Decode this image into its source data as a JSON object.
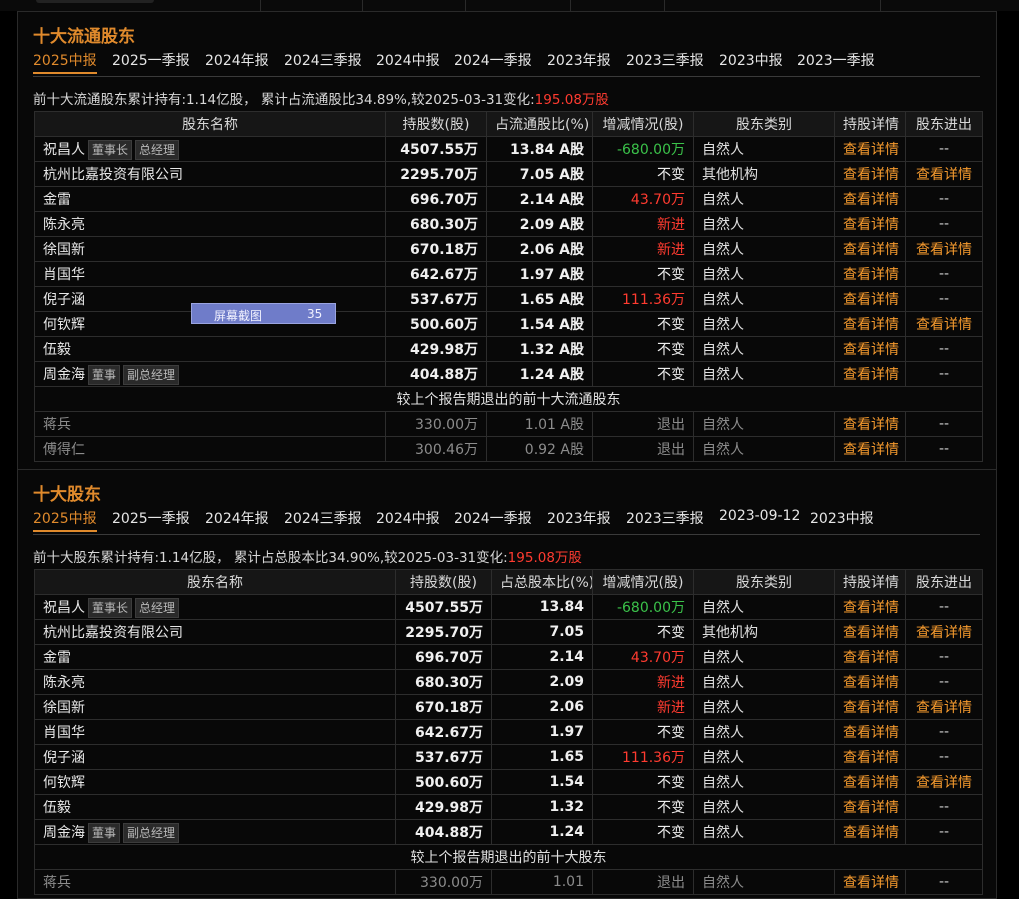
{
  "sections": [
    {
      "title": "十大流通股东",
      "tabs": [
        "2025中报",
        "2025一季报",
        "2024年报",
        "2024三季报",
        "2024中报",
        "2024一季报",
        "2023年报",
        "2023三季报",
        "2023中报",
        "2023一季报"
      ],
      "summary_prefix": "前十大流通股东累计持有:1.14亿股， 累计占流通股比34.89%,较2025-03-31变化:",
      "summary_change": "195.08万股",
      "headers": [
        "股东名称",
        "持股数(股)",
        "占流通股比(%)",
        "增减情况(股)",
        "股东类别",
        "持股详情",
        "股东进出"
      ],
      "rows": [
        {
          "name": "祝昌人",
          "tags": [
            "董事长",
            "总经理"
          ],
          "shares": "4507.55万",
          "ratio": "13.84 A股",
          "change": "-680.00万",
          "change_color": "green",
          "type": "自然人",
          "detail": "查看详情",
          "inout": "--"
        },
        {
          "name": "杭州比嘉投资有限公司",
          "tags": [],
          "shares": "2295.70万",
          "ratio": "7.05 A股",
          "change": "不变",
          "change_color": "white",
          "type": "其他机构",
          "detail": "查看详情",
          "inout": "查看详情"
        },
        {
          "name": "金雷",
          "tags": [],
          "shares": "696.70万",
          "ratio": "2.14 A股",
          "change": "43.70万",
          "change_color": "red",
          "type": "自然人",
          "detail": "查看详情",
          "inout": "--"
        },
        {
          "name": "陈永亮",
          "tags": [],
          "shares": "680.30万",
          "ratio": "2.09 A股",
          "change": "新进",
          "change_color": "red",
          "type": "自然人",
          "detail": "查看详情",
          "inout": "--"
        },
        {
          "name": "徐国新",
          "tags": [],
          "shares": "670.18万",
          "ratio": "2.06 A股",
          "change": "新进",
          "change_color": "red",
          "type": "自然人",
          "detail": "查看详情",
          "inout": "查看详情"
        },
        {
          "name": "肖国华",
          "tags": [],
          "shares": "642.67万",
          "ratio": "1.97 A股",
          "change": "不变",
          "change_color": "white",
          "type": "自然人",
          "detail": "查看详情",
          "inout": "--"
        },
        {
          "name": "倪子涵",
          "tags": [],
          "shares": "537.67万",
          "ratio": "1.65 A股",
          "change": "111.36万",
          "change_color": "red",
          "type": "自然人",
          "detail": "查看详情",
          "inout": "--"
        },
        {
          "name": "何钦辉",
          "tags": [],
          "shares": "500.60万",
          "ratio": "1.54 A股",
          "change": "不变",
          "change_color": "white",
          "type": "自然人",
          "detail": "查看详情",
          "inout": "查看详情"
        },
        {
          "name": "伍毅",
          "tags": [],
          "shares": "429.98万",
          "ratio": "1.32 A股",
          "change": "不变",
          "change_color": "white",
          "type": "自然人",
          "detail": "查看详情",
          "inout": "--"
        },
        {
          "name": "周金海",
          "tags": [
            "董事",
            "副总经理"
          ],
          "shares": "404.88万",
          "ratio": "1.24 A股",
          "change": "不变",
          "change_color": "white",
          "type": "自然人",
          "detail": "查看详情",
          "inout": "--"
        }
      ],
      "exit_label": "较上个报告期退出的前十大流通股东",
      "exited": [
        {
          "name": "蒋兵",
          "shares": "330.00万",
          "ratio": "1.01 A股",
          "change": "退出",
          "type": "自然人",
          "detail": "查看详情",
          "inout": "--"
        },
        {
          "name": "傅得仁",
          "shares": "300.46万",
          "ratio": "0.92 A股",
          "change": "退出",
          "type": "自然人",
          "detail": "查看详情",
          "inout": "--"
        }
      ]
    },
    {
      "title": "十大股东",
      "tabs": [
        "2025中报",
        "2025一季报",
        "2024年报",
        "2024三季报",
        "2024中报",
        "2024一季报",
        "2023年报",
        "2023三季报",
        "2023-09-12",
        "2023中报"
      ],
      "summary_prefix": "前十大股东累计持有:1.14亿股， 累计占总股本比34.90%,较2025-03-31变化:",
      "summary_change": "195.08万股",
      "headers": [
        "股东名称",
        "持股数(股)",
        "占总股本比(%)",
        "增减情况(股)",
        "股东类别",
        "持股详情",
        "股东进出"
      ],
      "rows": [
        {
          "name": "祝昌人",
          "tags": [
            "董事长",
            "总经理"
          ],
          "shares": "4507.55万",
          "ratio": "13.84",
          "change": "-680.00万",
          "change_color": "green",
          "type": "自然人",
          "detail": "查看详情",
          "inout": "--"
        },
        {
          "name": "杭州比嘉投资有限公司",
          "tags": [],
          "shares": "2295.70万",
          "ratio": "7.05",
          "change": "不变",
          "change_color": "white",
          "type": "其他机构",
          "detail": "查看详情",
          "inout": "查看详情"
        },
        {
          "name": "金雷",
          "tags": [],
          "shares": "696.70万",
          "ratio": "2.14",
          "change": "43.70万",
          "change_color": "red",
          "type": "自然人",
          "detail": "查看详情",
          "inout": "--"
        },
        {
          "name": "陈永亮",
          "tags": [],
          "shares": "680.30万",
          "ratio": "2.09",
          "change": "新进",
          "change_color": "red",
          "type": "自然人",
          "detail": "查看详情",
          "inout": "--"
        },
        {
          "name": "徐国新",
          "tags": [],
          "shares": "670.18万",
          "ratio": "2.06",
          "change": "新进",
          "change_color": "red",
          "type": "自然人",
          "detail": "查看详情",
          "inout": "查看详情"
        },
        {
          "name": "肖国华",
          "tags": [],
          "shares": "642.67万",
          "ratio": "1.97",
          "change": "不变",
          "change_color": "white",
          "type": "自然人",
          "detail": "查看详情",
          "inout": "--"
        },
        {
          "name": "倪子涵",
          "tags": [],
          "shares": "537.67万",
          "ratio": "1.65",
          "change": "111.36万",
          "change_color": "red",
          "type": "自然人",
          "detail": "查看详情",
          "inout": "--"
        },
        {
          "name": "何钦辉",
          "tags": [],
          "shares": "500.60万",
          "ratio": "1.54",
          "change": "不变",
          "change_color": "white",
          "type": "自然人",
          "detail": "查看详情",
          "inout": "查看详情"
        },
        {
          "name": "伍毅",
          "tags": [],
          "shares": "429.98万",
          "ratio": "1.32",
          "change": "不变",
          "change_color": "white",
          "type": "自然人",
          "detail": "查看详情",
          "inout": "--"
        },
        {
          "name": "周金海",
          "tags": [
            "董事",
            "副总经理"
          ],
          "shares": "404.88万",
          "ratio": "1.24",
          "change": "不变",
          "change_color": "white",
          "type": "自然人",
          "detail": "查看详情",
          "inout": "--"
        }
      ],
      "exit_label": "较上个报告期退出的前十大股东",
      "exited": [
        {
          "name": "蒋兵",
          "shares": "330.00万",
          "ratio": "1.01",
          "change": "退出",
          "type": "自然人",
          "detail": "查看详情",
          "inout": "--"
        }
      ]
    }
  ],
  "tooltip": {
    "label": "屏幕截图",
    "count": "35"
  }
}
